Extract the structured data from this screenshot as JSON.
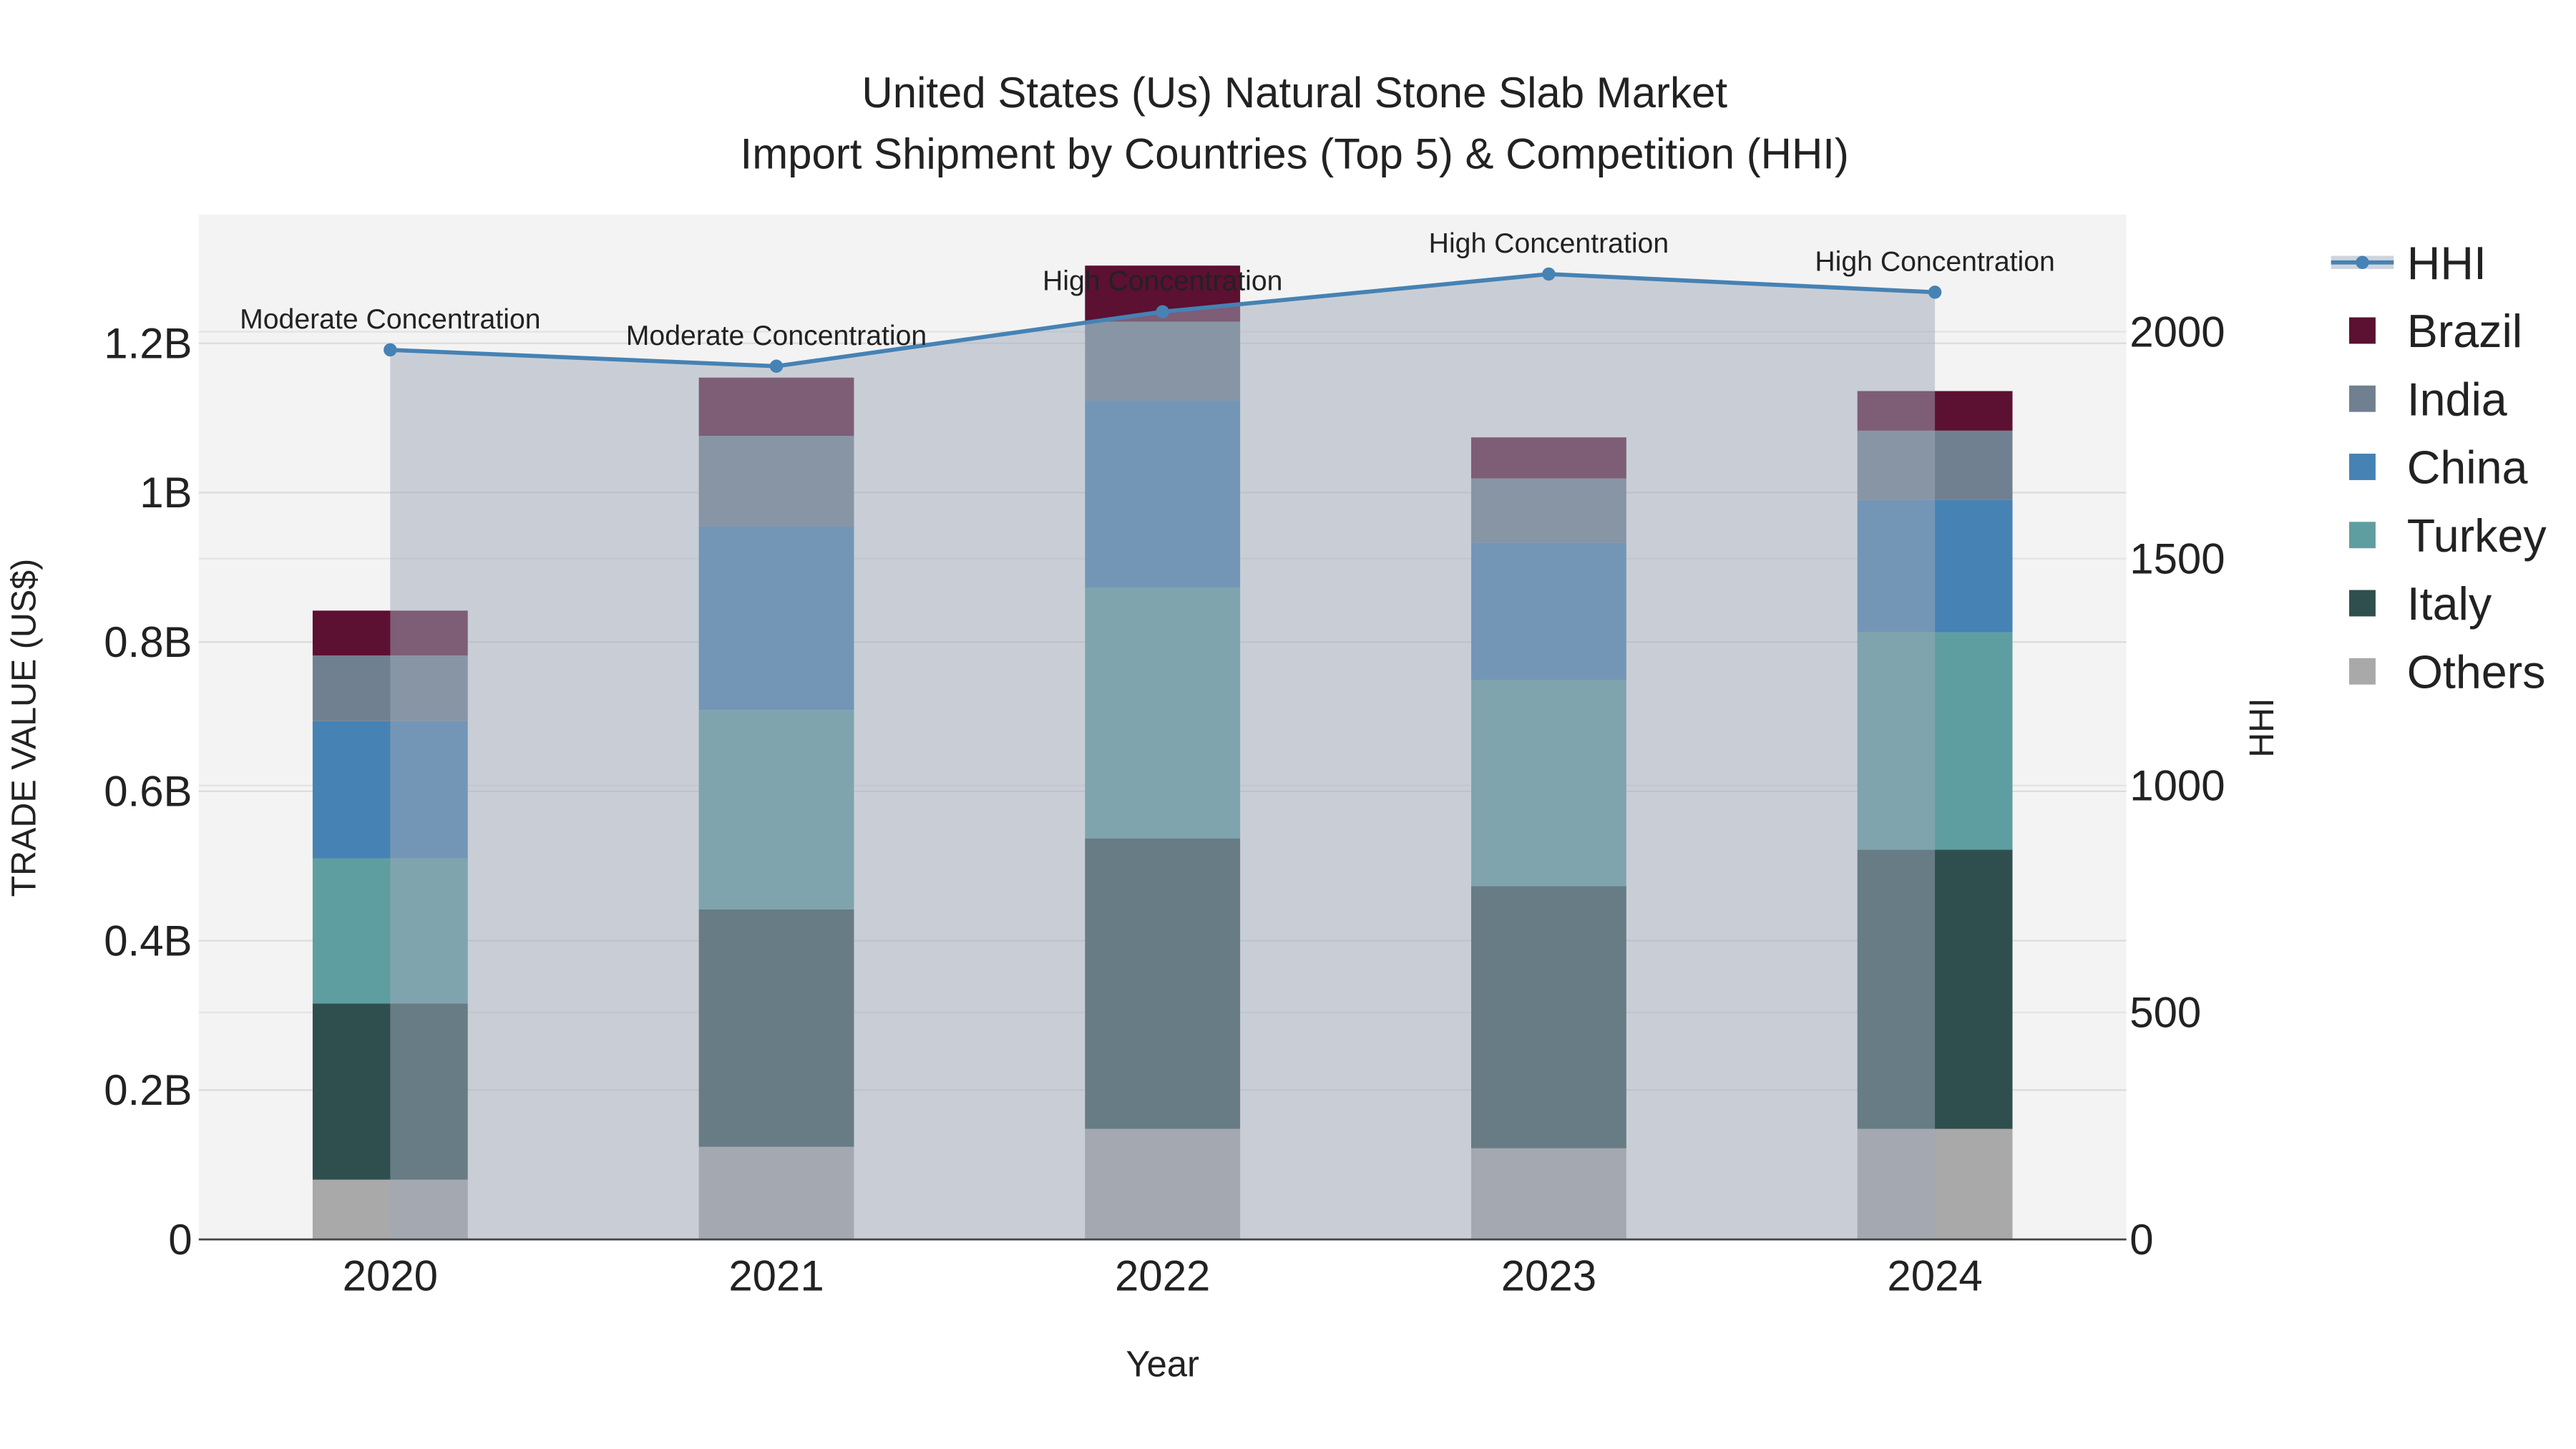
{
  "chart_data": {
    "type": "bar",
    "title_line1": "United States (Us) Natural Stone Slab Market",
    "title_line2": "Import Shipment by Countries (Top 5) & Competition (HHI)",
    "xlabel": "Year",
    "ylabel": "TRADE VALUE (US$)",
    "y2label": "HHI",
    "categories": [
      "2020",
      "2021",
      "2022",
      "2023",
      "2024"
    ],
    "ylim": [
      0,
      1.37
    ],
    "y2lim": [
      0,
      2256
    ],
    "yticks": [
      {
        "v": 0,
        "label": "0"
      },
      {
        "v": 0.2,
        "label": "0.2B"
      },
      {
        "v": 0.4,
        "label": "0.4B"
      },
      {
        "v": 0.6,
        "label": "0.6B"
      },
      {
        "v": 0.8,
        "label": "0.8B"
      },
      {
        "v": 1.0,
        "label": "1B"
      },
      {
        "v": 1.2,
        "label": "1.2B"
      }
    ],
    "y2ticks": [
      {
        "v": 0,
        "label": "0"
      },
      {
        "v": 500,
        "label": "500"
      },
      {
        "v": 1000,
        "label": "1000"
      },
      {
        "v": 1500,
        "label": "1500"
      },
      {
        "v": 2000,
        "label": "2000"
      }
    ],
    "value_unit": "billion US$",
    "series": [
      {
        "name": "Others",
        "color": "#a9a9a9",
        "values": [
          0.08,
          0.124,
          0.148,
          0.122,
          0.148
        ]
      },
      {
        "name": "Italy",
        "color": "#2f4f4f",
        "values": [
          0.236,
          0.318,
          0.389,
          0.351,
          0.374
        ]
      },
      {
        "name": "Turkey",
        "color": "#5f9ea0",
        "values": [
          0.194,
          0.267,
          0.336,
          0.276,
          0.291
        ]
      },
      {
        "name": "China",
        "color": "#4682b4",
        "values": [
          0.184,
          0.246,
          0.25,
          0.184,
          0.177
        ]
      },
      {
        "name": "India",
        "color": "#708090",
        "values": [
          0.088,
          0.121,
          0.106,
          0.086,
          0.093
        ]
      },
      {
        "name": "Brazil",
        "color": "#5c1032",
        "values": [
          0.06,
          0.078,
          0.075,
          0.055,
          0.053
        ]
      }
    ],
    "hhi": {
      "name": "HHI",
      "color": "#4682b4",
      "values": [
        1960,
        1924,
        2044,
        2127,
        2087
      ],
      "annotations": [
        "Moderate Concentration",
        "Moderate Concentration",
        "High Concentration",
        "High Concentration",
        "High Concentration"
      ]
    },
    "legend": [
      "HHI",
      "Brazil",
      "India",
      "China",
      "Turkey",
      "Italy",
      "Others"
    ],
    "legend_position": "right",
    "grid": true
  }
}
